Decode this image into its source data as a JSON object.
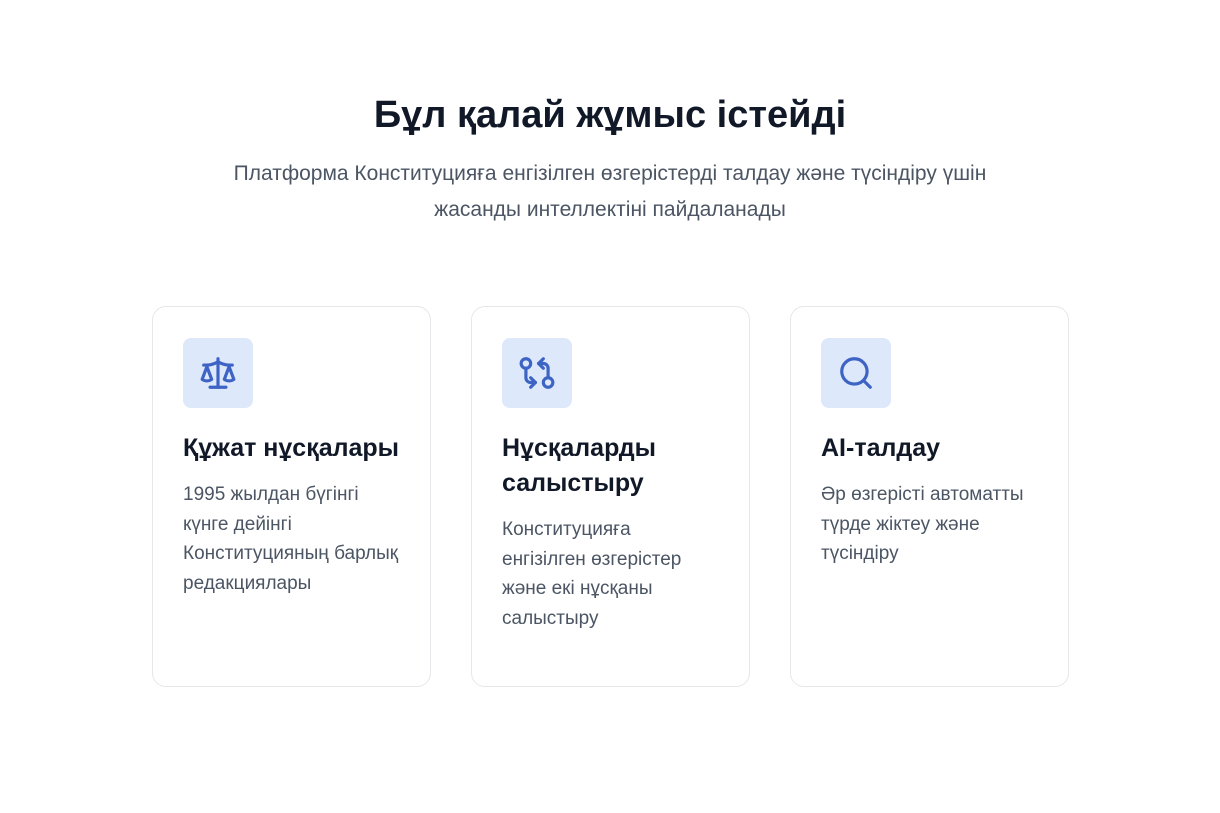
{
  "section": {
    "title": "Бұл қалай жұмыс істейді",
    "subtitle": "Платформа Конституцияға енгізілген өзгерістерді талдау және түсіндіру үшін жасанды интеллектіні пайдаланады"
  },
  "colors": {
    "accent": "#3d63c4",
    "icon_background": "#dde8fb",
    "title_text": "#111827",
    "body_text": "#4b5563",
    "card_border": "#e5e7eb"
  },
  "cards": [
    {
      "icon": "scale-icon",
      "title": "Құжат нұсқалары",
      "description": "1995 жылдан бүгінгі күнге дейінгі Конституцияның барлық редакциялары"
    },
    {
      "icon": "git-compare-icon",
      "title": "Нұсқаларды салыстыру",
      "description": "Конституцияға енгізілген өзгерістер және екі нұсқаны салыстыру"
    },
    {
      "icon": "search-icon",
      "title": "AI-талдау",
      "description": "Әр өзгерісті автоматты түрде жіктеу және түсіндіру"
    }
  ]
}
